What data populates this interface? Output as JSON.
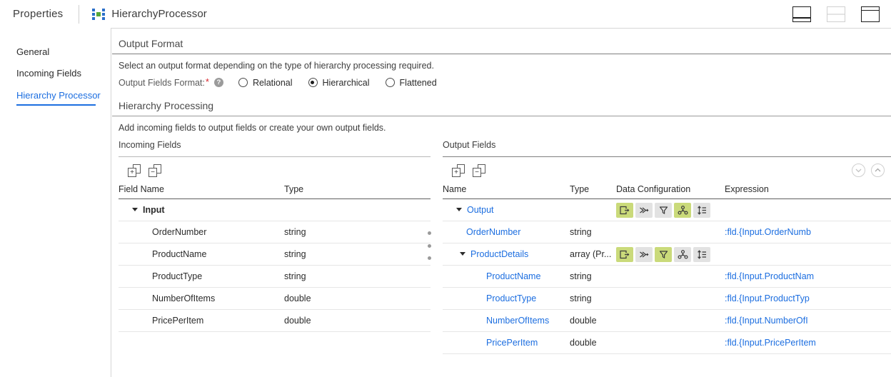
{
  "titlebar": {
    "properties_label": "Properties",
    "node_name": "HierarchyProcessor",
    "layout_buttons": [
      {
        "name": "layout-bottom-panel",
        "label": ""
      },
      {
        "name": "layout-split-panel",
        "label": ""
      },
      {
        "name": "layout-top-panel",
        "label": ""
      }
    ]
  },
  "sidebar": {
    "items": [
      {
        "label": "General",
        "selected": false
      },
      {
        "label": "Incoming Fields",
        "selected": false
      },
      {
        "label": "Hierarchy Processor",
        "selected": true
      }
    ]
  },
  "output_format": {
    "title": "Output Format",
    "description": "Select an output format depending on the type of hierarchy processing required.",
    "field_label": "Output Fields Format:",
    "required_marker": "*",
    "help_icon": "?",
    "options": [
      {
        "label": "Relational",
        "selected": false
      },
      {
        "label": "Hierarchical",
        "selected": true
      },
      {
        "label": "Flattened",
        "selected": false
      }
    ]
  },
  "hierarchy_processing": {
    "title": "Hierarchy Processing",
    "description": "Add incoming fields to output fields or create your own output fields."
  },
  "incoming_fields": {
    "panel_title": "Incoming Fields",
    "toolbar": {
      "add_label": "+",
      "remove_label": "−"
    },
    "columns": [
      "Field Name",
      "Type"
    ],
    "rows": [
      {
        "name": "Input",
        "type": "",
        "group": true,
        "expanded": true,
        "indent": 0
      },
      {
        "name": "OrderNumber",
        "type": "string",
        "group": false,
        "indent": 1
      },
      {
        "name": "ProductName",
        "type": "string",
        "group": false,
        "indent": 1
      },
      {
        "name": "ProductType",
        "type": "string",
        "group": false,
        "indent": 1
      },
      {
        "name": "NumberOfItems",
        "type": "double",
        "group": false,
        "indent": 1
      },
      {
        "name": "PricePerItem",
        "type": "double",
        "group": false,
        "indent": 1
      }
    ]
  },
  "output_fields": {
    "panel_title": "Output Fields",
    "toolbar": {
      "add_label": "+",
      "remove_label": "−",
      "move_down_label": "⌄",
      "move_up_label": "⌃"
    },
    "columns": [
      "Name",
      "Type",
      "Data Configuration",
      "Expression"
    ],
    "config_icon_names": [
      "output-icon",
      "join-icon",
      "filter-icon",
      "group-by-icon",
      "sort-icon"
    ],
    "rows": [
      {
        "name": "Output",
        "type": "",
        "expression": "",
        "group": true,
        "expanded": true,
        "indent": 0,
        "config": [
          true,
          false,
          false,
          true,
          false
        ]
      },
      {
        "name": "OrderNumber",
        "type": "string",
        "expression": ":fld.{Input.OrderNumb",
        "group": false,
        "indent": 1,
        "config": []
      },
      {
        "name": "ProductDetails",
        "type": "array (Pr...",
        "expression": "",
        "group": true,
        "expanded": true,
        "indent": 1,
        "config": [
          true,
          false,
          true,
          false,
          false
        ]
      },
      {
        "name": "ProductName",
        "type": "string",
        "expression": ":fld.{Input.ProductNam",
        "group": false,
        "indent": 2,
        "config": []
      },
      {
        "name": "ProductType",
        "type": "string",
        "expression": ":fld.{Input.ProductTyp",
        "group": false,
        "indent": 2,
        "config": []
      },
      {
        "name": "NumberOfItems",
        "type": "double",
        "expression": ":fld.{Input.NumberOfI",
        "group": false,
        "indent": 2,
        "config": []
      },
      {
        "name": "PricePerItem",
        "type": "double",
        "expression": ":fld.{Input.PricePerItem",
        "group": false,
        "indent": 2,
        "config": []
      }
    ]
  },
  "colors": {
    "accent_blue": "#1c6ee0",
    "config_active_green": "#cada7a",
    "config_inactive_gray": "#e2e2e2",
    "required_red": "#d8232a"
  }
}
